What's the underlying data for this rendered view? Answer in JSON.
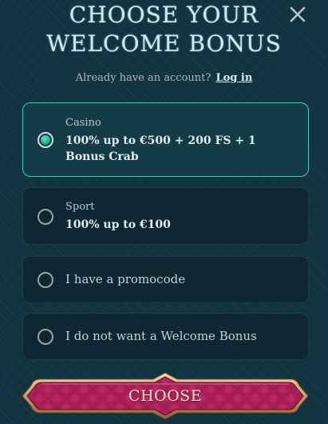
{
  "header": {
    "title_line1": "Choose your",
    "title_line2": "Welcome Bonus",
    "close_icon": "close-icon"
  },
  "account": {
    "prompt": "Already have an account?",
    "login_label": "Log in"
  },
  "options": [
    {
      "category": "Casino",
      "description": "100% up to €500 + 200 FS + 1 Bonus Crab",
      "selected": true
    },
    {
      "category": "Sport",
      "description": "100% up to €100",
      "selected": false
    },
    {
      "label": "I have a promocode",
      "selected": false
    },
    {
      "label": "I do not want a Welcome Bonus",
      "selected": false
    }
  ],
  "cta": {
    "label": "Choose"
  },
  "colors": {
    "background": "#123440",
    "selected_border": "#4bc6b3",
    "button_fill": "#b5225e",
    "button_frame": "#d6b488"
  }
}
